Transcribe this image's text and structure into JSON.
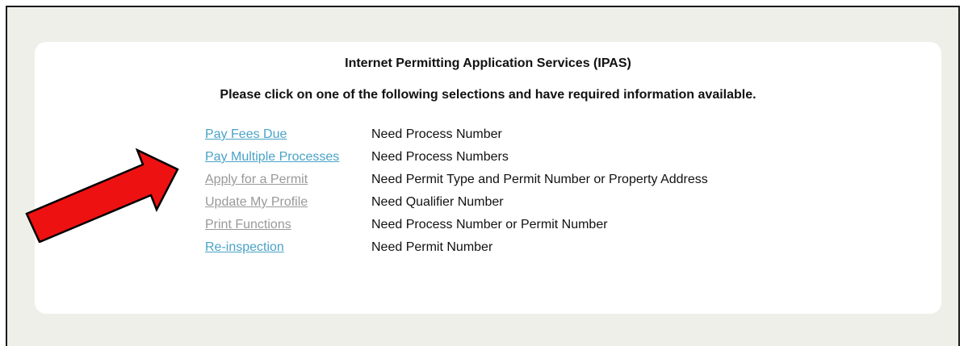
{
  "panel": {
    "title": "Internet Permitting Application Services (IPAS)",
    "instructions": "Please click on one of the following selections and have required information available."
  },
  "options": [
    {
      "label": "Pay Fees Due",
      "requirement": "Need Process Number",
      "state": "active"
    },
    {
      "label": "Pay Multiple Processes",
      "requirement": "Need Process Numbers",
      "state": "active"
    },
    {
      "label": "Apply for a Permit",
      "requirement": "Need Permit Type and Permit Number or Property Address",
      "state": "disabled"
    },
    {
      "label": "Update My Profile",
      "requirement": "Need Qualifier Number",
      "state": "disabled"
    },
    {
      "label": "Print Functions",
      "requirement": "Need Process Number or Permit Number",
      "state": "disabled"
    },
    {
      "label": "Re-inspection",
      "requirement": "Need Permit Number",
      "state": "active"
    }
  ],
  "annotation": {
    "icon": "red-arrow-icon",
    "fill_color": "#ee1111",
    "stroke_color": "#000000"
  },
  "colors": {
    "link_active": "#4aa3c7",
    "link_disabled": "#999999",
    "background": "#efefea",
    "panel": "#ffffff"
  }
}
